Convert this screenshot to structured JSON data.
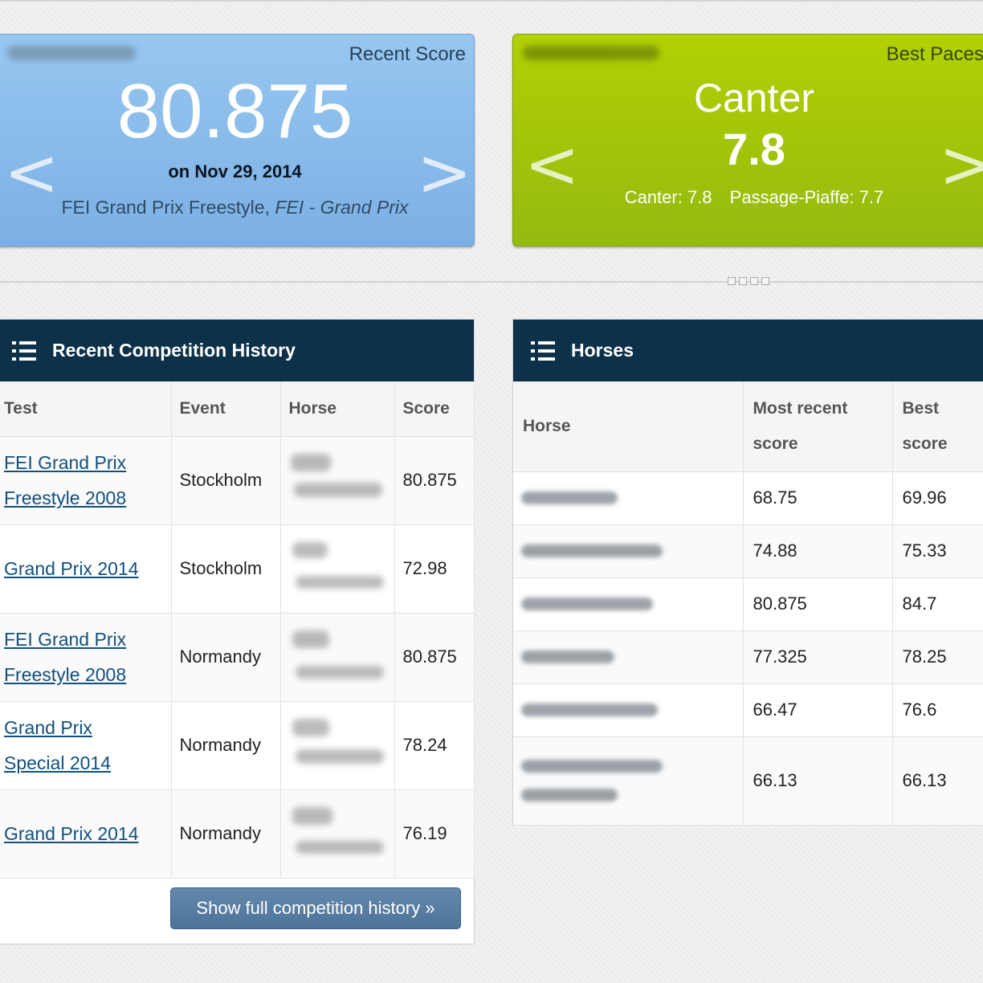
{
  "recent_score_card": {
    "label": "Recent Score",
    "score": "80.875",
    "date": "on Nov 29, 2014",
    "test_name": "FEI Grand Prix Freestyle,",
    "test_level": "FEI - Grand Prix",
    "prev": "<",
    "next": ">"
  },
  "best_paces_card": {
    "label": "Best Paces",
    "pace": "Canter",
    "value": "7.8",
    "detail_1": "Canter: 7.8",
    "detail_2": "Passage-Piaffe: 7.7",
    "prev": "<",
    "next": ">"
  },
  "history_panel": {
    "title": "Recent Competition History",
    "columns": [
      "Test",
      "Event",
      "Horse",
      "Score"
    ],
    "rows": [
      {
        "test_line1": "FEI Grand Prix",
        "test_line2": "Freestyle 2008",
        "event": "Stockholm",
        "score": "80.875"
      },
      {
        "test_line1": "Grand Prix 2014",
        "test_line2": "",
        "event": "Stockholm",
        "score": "72.98"
      },
      {
        "test_line1": "FEI Grand Prix",
        "test_line2": "Freestyle 2008",
        "event": "Normandy",
        "score": "80.875"
      },
      {
        "test_line1": "Grand Prix",
        "test_line2": "Special 2014",
        "event": "Normandy",
        "score": "78.24"
      },
      {
        "test_line1": "Grand Prix 2014",
        "test_line2": "",
        "event": "Normandy",
        "score": "76.19"
      }
    ],
    "button": "Show full competition history »"
  },
  "horses_panel": {
    "title": "Horses",
    "columns": {
      "horse": "Horse",
      "recent_1": "Most recent",
      "recent_2": "score",
      "best_1": "Best",
      "best_2": "score"
    },
    "rows": [
      {
        "recent": "68.75",
        "best": "69.96"
      },
      {
        "recent": "74.88",
        "best": "75.33"
      },
      {
        "recent": "80.875",
        "best": "84.7"
      },
      {
        "recent": "77.325",
        "best": "78.25"
      },
      {
        "recent": "66.47",
        "best": "76.6"
      },
      {
        "recent": "66.13",
        "best": "66.13"
      }
    ]
  }
}
